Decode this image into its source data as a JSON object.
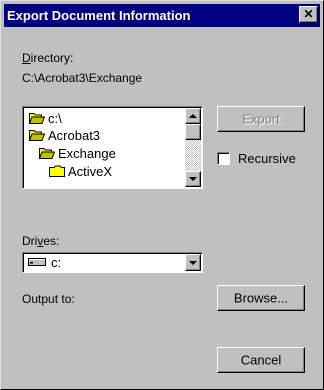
{
  "dialog": {
    "title": "Export Document Information",
    "close_glyph": "✕"
  },
  "directory": {
    "label": "Directory:",
    "label_accel": "D",
    "label_rest": "irectory:",
    "path": "C:\\Acrobat3\\Exchange"
  },
  "tree": {
    "items": [
      {
        "label": "c:\\",
        "icon": "open-folder-icon"
      },
      {
        "label": "Acrobat3",
        "icon": "open-folder-icon"
      },
      {
        "label": "Exchange",
        "icon": "open-folder-icon"
      },
      {
        "label": "ActiveX",
        "icon": "folder-icon"
      }
    ]
  },
  "buttons": {
    "export": "Export",
    "browse": "Browse...",
    "cancel": "Cancel"
  },
  "recursive": {
    "label": "Recursive",
    "checked": false
  },
  "drives": {
    "label": "Drives:",
    "label_accel": "v",
    "label_pre": "Dri",
    "label_post": "es:",
    "selected": "c:",
    "icon": "drive-icon"
  },
  "output": {
    "label": "Output to:"
  },
  "colors": {
    "titlebar": "#000080",
    "face": "#c0c0c0",
    "folder": "#ffff00"
  }
}
